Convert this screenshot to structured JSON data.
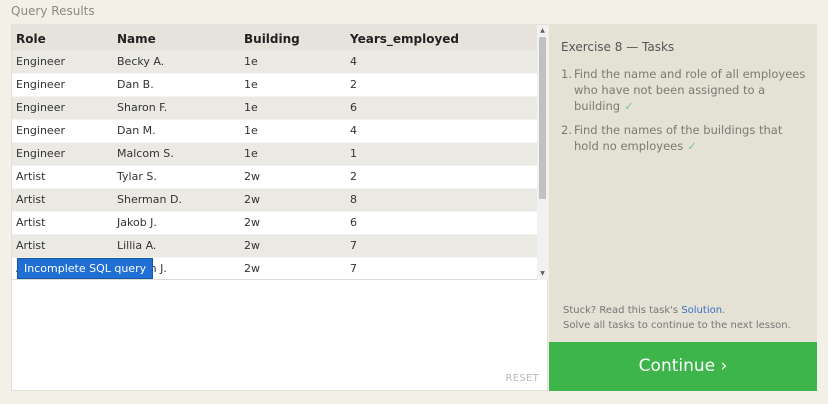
{
  "section_title": "Query Results",
  "table": {
    "columns": [
      "Role",
      "Name",
      "Building",
      "Years_employed"
    ],
    "rows": [
      [
        "Engineer",
        "Becky A.",
        "1e",
        "4"
      ],
      [
        "Engineer",
        "Dan B.",
        "1e",
        "2"
      ],
      [
        "Engineer",
        "Sharon F.",
        "1e",
        "6"
      ],
      [
        "Engineer",
        "Dan M.",
        "1e",
        "4"
      ],
      [
        "Engineer",
        "Malcom S.",
        "1e",
        "1"
      ],
      [
        "Artist",
        "Tylar S.",
        "2w",
        "2"
      ],
      [
        "Artist",
        "Sherman D.",
        "2w",
        "8"
      ],
      [
        "Artist",
        "Jakob J.",
        "2w",
        "6"
      ],
      [
        "Artist",
        "Lillia A.",
        "2w",
        "7"
      ],
      [
        "A",
        "ndon J.",
        "2w",
        "7"
      ]
    ]
  },
  "tooltip": "Incomplete SQL query",
  "reset_label": "RESET",
  "tasks": {
    "title": "Exercise 8 — Tasks",
    "items": [
      {
        "num": "1.",
        "text": "Find the name and role of all employees who have not been assigned to a building",
        "check": "✓"
      },
      {
        "num": "2.",
        "text": "Find the names of the buildings that hold no employees",
        "check": "✓"
      }
    ],
    "stuck_prefix": "Stuck? Read this task's ",
    "solution_link": "Solution",
    "stuck_suffix": ".",
    "solve_line": "Solve all tasks to continue to the next lesson."
  },
  "continue_label": "Continue ›",
  "colors": {
    "accent_green": "#3db54a",
    "tooltip_blue": "#1f6fd4",
    "link_blue": "#3a6fc4"
  }
}
